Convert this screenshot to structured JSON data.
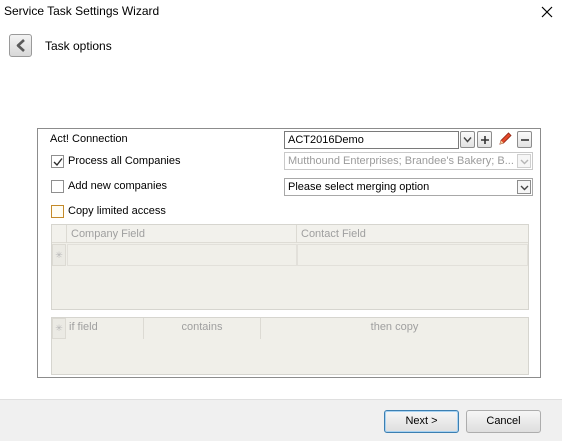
{
  "window": {
    "title": "Service Task Settings Wizard",
    "close_icon": "close-icon"
  },
  "header": {
    "back_icon": "chevron-left-icon",
    "title": "Task options"
  },
  "connection": {
    "label": "Act! Connection",
    "value": "ACT2016Demo",
    "buttons": [
      "dropdown",
      "add",
      "edit",
      "remove"
    ]
  },
  "options": {
    "process_all": {
      "label": "Process all Companies",
      "checked": true
    },
    "companies_value": "Mutthound Enterprises; Brandee's Bakery; B...",
    "add_new": {
      "label": "Add new companies",
      "checked": false
    },
    "merge_placeholder": "Please select merging option",
    "copy_limited": {
      "label": "Copy limited access",
      "checked": false
    }
  },
  "mapping_grid": {
    "columns": [
      "Company Field",
      "Contact Field"
    ]
  },
  "rules_grid": {
    "columns": [
      "if field",
      "contains",
      "then copy"
    ]
  },
  "footer": {
    "next_label": "Next >",
    "cancel_label": "Cancel"
  },
  "colors": {
    "edit_icon": "#d63b1f",
    "checkbox_orange": "#c48a2a"
  }
}
